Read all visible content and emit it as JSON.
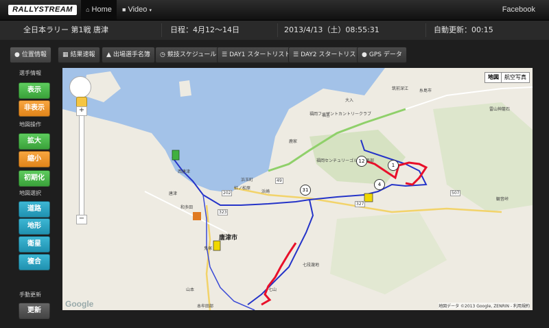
{
  "nav": {
    "brand": "RALLYSTREAM",
    "home_label": "Home",
    "video_label": "Video",
    "facebook_label": "Facebook"
  },
  "info": {
    "event_name": "全日本ラリー 第1戦 唐津",
    "schedule": "日程：4月12〜14日",
    "datetime": "2013/4/13（土）08:55:31",
    "auto_update": "自動更新：00:15"
  },
  "tabs": [
    {
      "label": "位置情報",
      "icon": "globe-icon"
    },
    {
      "label": "結果速報",
      "icon": "table-icon"
    },
    {
      "label": "出場選手名簿",
      "icon": "person-icon"
    },
    {
      "label": "競技スケジュール",
      "icon": "clock-icon"
    },
    {
      "label": "DAY1 スタートリスト",
      "icon": "list-icon"
    },
    {
      "label": "DAY2 スタートリスト",
      "icon": "list-icon"
    },
    {
      "label": "GPS データ",
      "icon": "globe-icon"
    }
  ],
  "sidebar": {
    "player_info_label": "選手情報",
    "show_label": "表示",
    "hide_label": "非表示",
    "map_ops_label": "地図操作",
    "zoom_in_label": "拡大",
    "zoom_out_label": "縮小",
    "reset_label": "初期化",
    "map_select_label": "地図選択",
    "road_label": "道路",
    "terrain_label": "地形",
    "satellite_label": "衛星",
    "hybrid_label": "複合",
    "manual_update_label": "手動更新",
    "update_label": "更新"
  },
  "map": {
    "type_map": "地図",
    "type_satellite": "航空写真",
    "google_logo": "Google",
    "attribution": "地図データ ©2013 Google, ZENRIN - 利用規約",
    "city_karatsu": "唐津市",
    "labels": [
      "筑前深江",
      "大入",
      "福吉",
      "大入",
      "西唐津",
      "唐津",
      "和多田",
      "鬼塚",
      "山本",
      "本牟田部",
      "七段瀧地",
      "七山",
      "浜崎",
      "虹ノ松原",
      "観音峠",
      "雷山神籠石",
      "糸島市",
      "鹿家",
      "浜玉町",
      "福岡センチュリーゴルフ倶楽部",
      "福岡フェザントカントリークラブ"
    ],
    "pins": [
      "12",
      "1",
      "4",
      "31"
    ],
    "road_numbers": [
      "327",
      "202",
      "323",
      "49",
      "507"
    ],
    "colors": {
      "water": "#a3c2e8",
      "land": "#eeebe2",
      "route_red": "#e8102a",
      "route_blue": "#2433c8",
      "forest": "#d6e2c2"
    }
  }
}
